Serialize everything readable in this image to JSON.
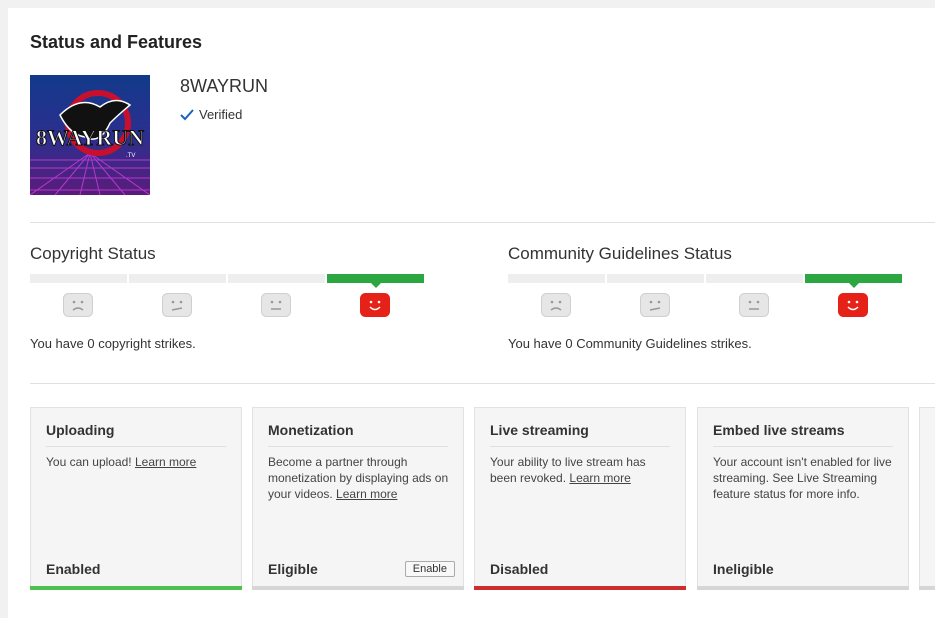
{
  "page_title": "Status and Features",
  "channel": {
    "name": "8WAYRUN",
    "verified_label": "Verified",
    "avatar_text": "8WAYRUN",
    "avatar_suffix": ".TV"
  },
  "copyright": {
    "title": "Copyright Status",
    "strike_text": "You have 0 copyright strikes.",
    "faces": [
      "sad-face-icon",
      "meh-face-icon",
      "neutral-face-icon",
      "happy-face-icon"
    ],
    "active_index": 3
  },
  "community": {
    "title": "Community Guidelines Status",
    "strike_text": "You have 0 Community Guidelines strikes.",
    "faces": [
      "sad-face-icon",
      "meh-face-icon",
      "neutral-face-icon",
      "happy-face-icon"
    ],
    "active_index": 3
  },
  "features": [
    {
      "title": "Uploading",
      "desc": "You can upload!",
      "link": "Learn more",
      "status": "Enabled",
      "bar_color": "#4ec04e"
    },
    {
      "title": "Monetization",
      "desc": "Become a partner through monetization by displaying ads on your videos.",
      "link": "Learn more",
      "status": "Eligible",
      "button": "Enable",
      "bar_color": "#d6d6d6"
    },
    {
      "title": "Live streaming",
      "desc": "Your ability to live stream has been revoked.",
      "link": "Learn more",
      "status": "Disabled",
      "bar_color": "#cc2e2e"
    },
    {
      "title": "Embed live streams",
      "desc": "Your account isn't enabled for live streaming. See Live Streaming feature status for more info.",
      "status": "Ineligible",
      "bar_color": "#d6d6d6"
    }
  ],
  "colors": {
    "active_green": "#2ba640",
    "strike_red": "#e62117",
    "face_grey": "#e6e6e6"
  }
}
